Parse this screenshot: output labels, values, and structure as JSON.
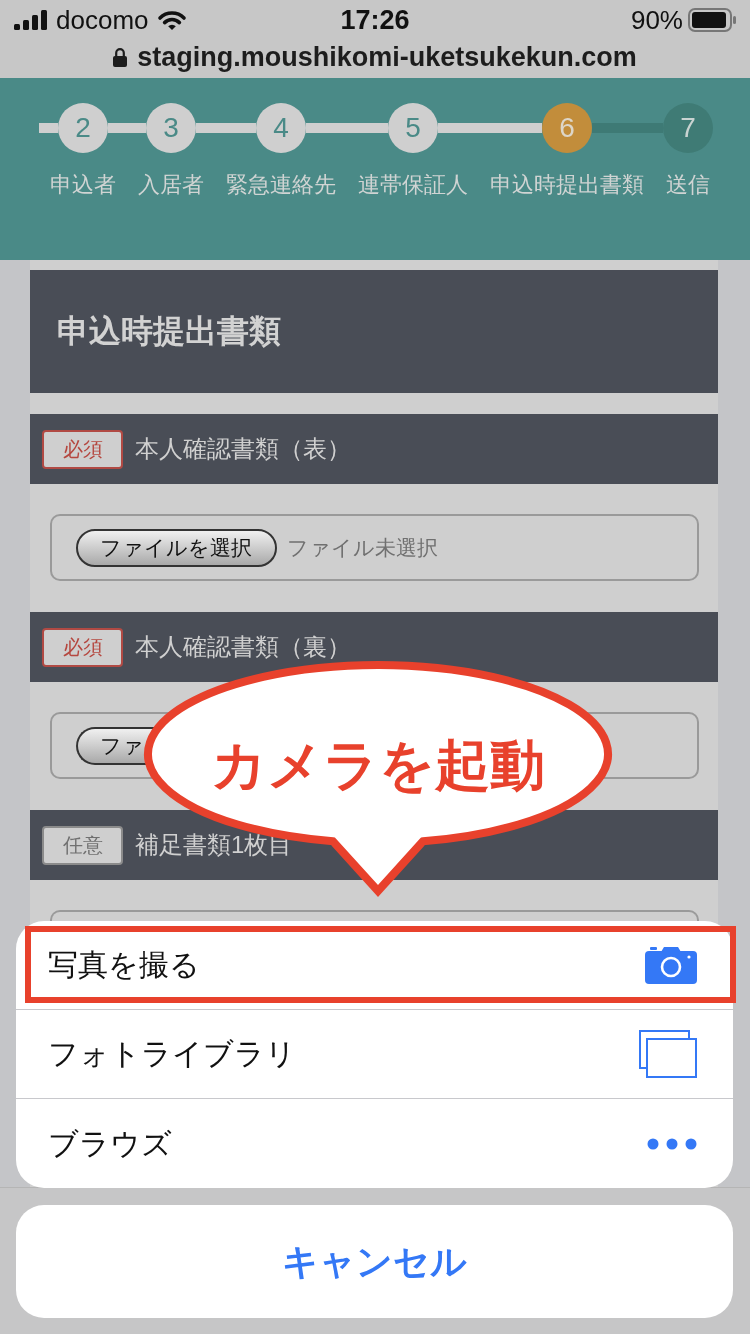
{
  "status_bar": {
    "carrier": "docomo",
    "time": "17:26",
    "battery": "90%"
  },
  "address_bar": {
    "url": "staging.moushikomi-uketsukekun.com"
  },
  "stepper": {
    "steps": [
      {
        "number": "2",
        "label": "申込者",
        "completed": true,
        "selected": false
      },
      {
        "number": "3",
        "label": "入居者",
        "completed": true,
        "selected": false
      },
      {
        "number": "4",
        "label": "緊急連絡先",
        "completed": true,
        "selected": false
      },
      {
        "number": "5",
        "label": "連帯保証人",
        "completed": true,
        "selected": false
      },
      {
        "number": "6",
        "label": "申込時提出書類",
        "completed": false,
        "selected": true
      },
      {
        "number": "7",
        "label": "送信",
        "completed": false,
        "selected": false
      }
    ]
  },
  "page": {
    "title": "申込時提出書類",
    "documents": [
      {
        "badge": "必須",
        "required": true,
        "label": "本人確認書類（表）",
        "file_button": "ファイルを選択",
        "file_status": "ファイル未選択"
      },
      {
        "badge": "必須",
        "required": true,
        "label": "本人確認書類（裏）",
        "file_button": "ファ"
      },
      {
        "badge": "任意",
        "required": false,
        "label": "補足書類1枚目"
      }
    ]
  },
  "callout": {
    "text": "カメラを起動"
  },
  "action_sheet": {
    "options": [
      {
        "label": "写真を撮る",
        "kind": "camera",
        "highlighted": true
      },
      {
        "label": "フォトライブラリ",
        "kind": "photos",
        "highlighted": false
      },
      {
        "label": "ブラウズ",
        "kind": "more",
        "highlighted": false
      }
    ],
    "cancel": "キャンセル"
  }
}
